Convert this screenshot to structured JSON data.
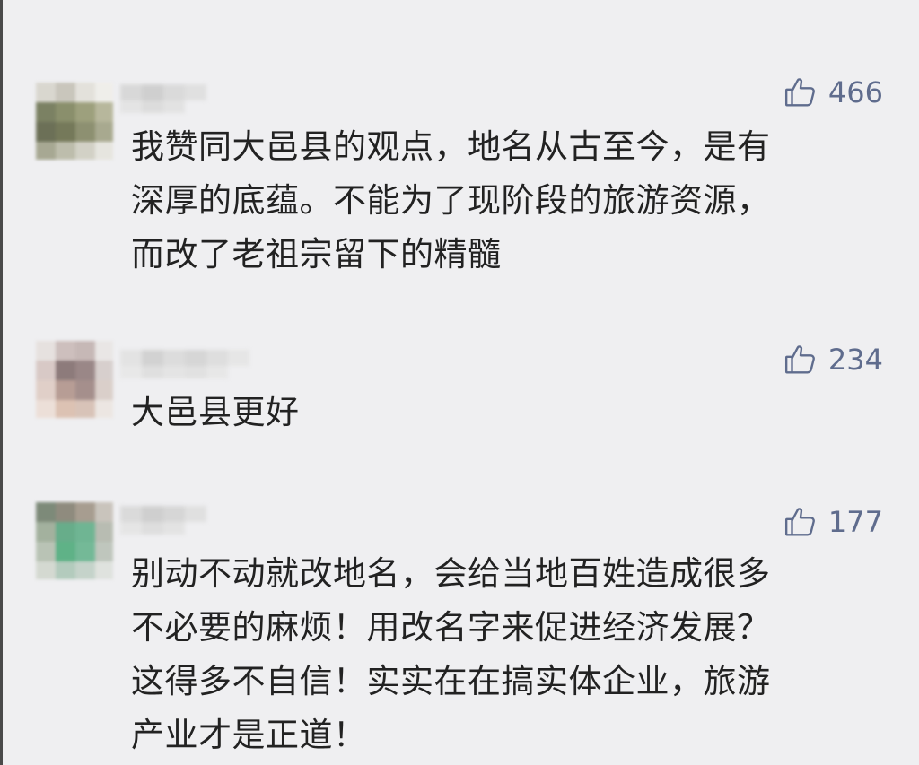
{
  "comments": [
    {
      "likes": "466",
      "text": "我赞同大邑县的观点，地名从古至今，是有\n深厚的底蕴。不能为了现阶段的旅游资源，\n而改了老祖宗留下的精髓"
    },
    {
      "likes": "234",
      "text": "大邑县更好"
    },
    {
      "likes": "177",
      "text": "别动不动就改地名，会给当地百姓造成很多\n不必要的麻烦！用改名字来促进经济发展？\n这得多不自信！实实在在搞实体企业，旅游\n产业才是正道！"
    }
  ],
  "icons": {
    "like": "thumbs-up-icon"
  },
  "colors": {
    "background": "#efeff1",
    "like_text": "#5f6c8d",
    "comment_text": "#222222"
  }
}
